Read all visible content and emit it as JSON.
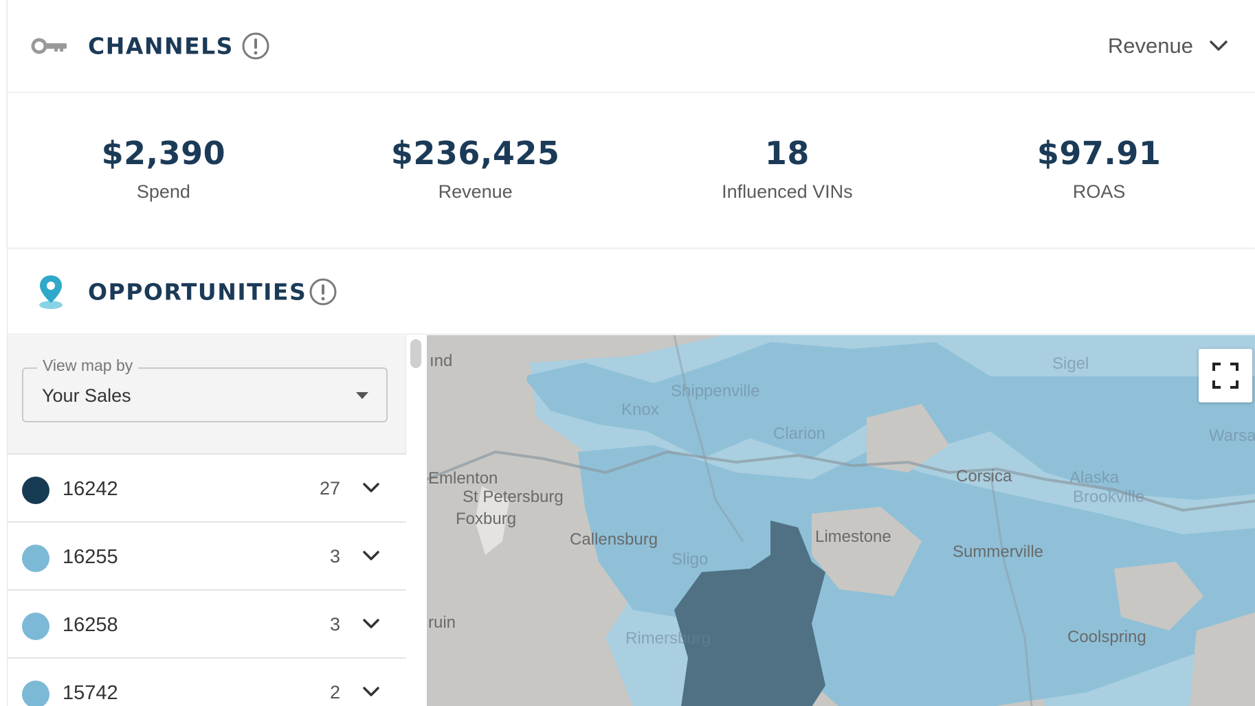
{
  "channels": {
    "title": "CHANNELS",
    "metric_selector": "Revenue",
    "stats": [
      {
        "value": "$2,390",
        "label": "Spend"
      },
      {
        "value": "$236,425",
        "label": "Revenue"
      },
      {
        "value": "18",
        "label": "Influenced VINs"
      },
      {
        "value": "$97.91",
        "label": "ROAS"
      }
    ]
  },
  "opportunities": {
    "title": "OPPORTUNITIES",
    "view_map_by": {
      "legend": "View map by",
      "value": "Your Sales"
    },
    "zips": [
      {
        "zip": "16242",
        "count": "27",
        "color": "#173b52"
      },
      {
        "zip": "16255",
        "count": "3",
        "color": "#7cb9d6"
      },
      {
        "zip": "16258",
        "count": "3",
        "color": "#7cb9d6"
      },
      {
        "zip": "15742",
        "count": "2",
        "color": "#7cb9d6"
      }
    ],
    "map_labels": {
      "ind": "ınd",
      "knox": "Knox",
      "shippenville": "Shippenville",
      "sigel": "Sigel",
      "clarion": "Clarion",
      "warsaw": "Warsav",
      "emlenton": "Emlenton",
      "st_petersburg": "St Petersburg",
      "foxburg": "Foxburg",
      "corsica": "Corsica",
      "alaska": "Alaska",
      "brookville": "Brookville",
      "callensburg": "Callensburg",
      "limestone": "Limestone",
      "summerville": "Summerville",
      "sligo": "Sligo",
      "ruin": "ruin",
      "rimersburg": "Rimersburg",
      "coolspring": "Coolspring"
    }
  },
  "colors": {
    "brand_dark": "#1b3a57",
    "map_light": "#a9cfe0",
    "map_mid": "#8fc0d8",
    "map_dark": "#4f7183",
    "map_gray": "#c9c7c3"
  }
}
